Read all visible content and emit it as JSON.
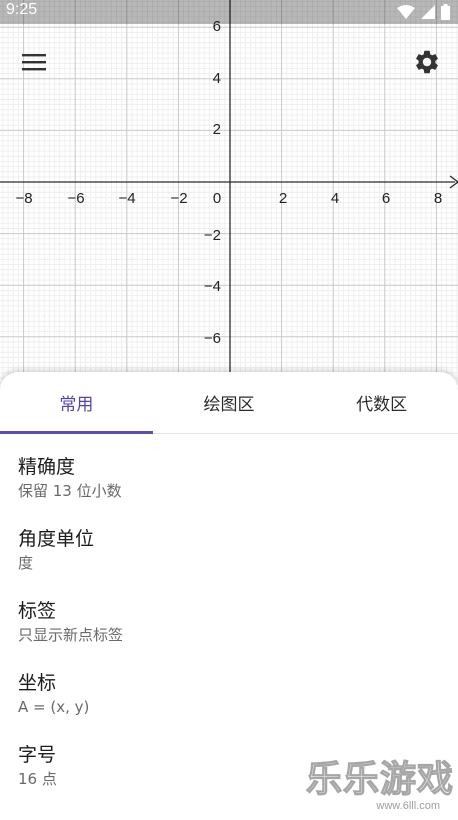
{
  "status_bar": {
    "time": "9:25"
  },
  "graph": {
    "x_ticks": [
      "−8",
      "−6",
      "−4",
      "−2",
      "0",
      "2",
      "4",
      "6",
      "8"
    ],
    "y_ticks_pos": [
      "6",
      "4",
      "2"
    ],
    "y_ticks_neg": [
      "−2",
      "−4",
      "−6"
    ],
    "colors": {
      "major_grid": "#c8c8c8",
      "minor_grid": "#ececec",
      "axis": "#2a2a2a"
    }
  },
  "toolbar": {
    "menu_icon": "hamburger-menu-icon",
    "settings_icon": "gear-icon"
  },
  "tabs": [
    {
      "label": "常用"
    },
    {
      "label": "绘图区"
    },
    {
      "label": "代数区"
    }
  ],
  "settings": [
    {
      "title": "精确度",
      "value": "保留 13 位小数"
    },
    {
      "title": "角度单位",
      "value": "度"
    },
    {
      "title": "标签",
      "value": "只显示新点标签"
    },
    {
      "title": "坐标",
      "value": "A = (x, y)"
    },
    {
      "title": "字号",
      "value": "16 点"
    }
  ],
  "watermark": {
    "text": "乐乐游戏",
    "url": "www.6lll.com"
  },
  "accent_color": "#5b4fb4"
}
